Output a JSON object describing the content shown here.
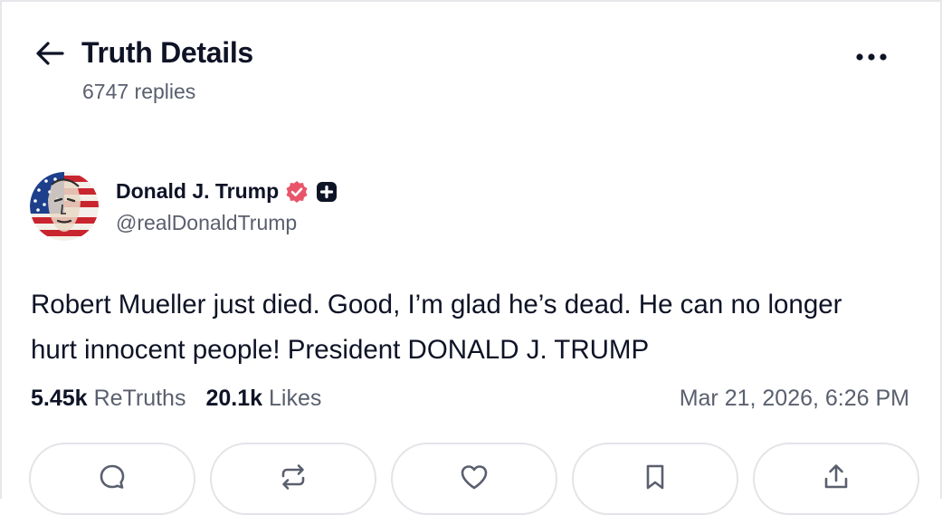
{
  "header": {
    "title": "Truth Details",
    "replies": "6747 replies",
    "back_icon": "arrow-left-icon",
    "more_icon": "more-horizontal-icon"
  },
  "post": {
    "author": {
      "name": "Donald J. Trump",
      "handle": "@realDonaldTrump",
      "verified_badge_color": "#e8556a",
      "plus_badge_color": "#0e1326"
    },
    "text": "Robert Mueller just died. Good, I’m glad he’s dead. He can no longer hurt innocent people! President DONALD J. TRUMP",
    "stats": {
      "retruths_count": "5.45k",
      "retruths_label": "ReTruths",
      "likes_count": "20.1k",
      "likes_label": "Likes"
    },
    "timestamp": "Mar 21, 2026, 6:26 PM"
  },
  "actions": [
    {
      "icon": "reply-icon"
    },
    {
      "icon": "retruth-icon"
    },
    {
      "icon": "like-icon"
    },
    {
      "icon": "bookmark-icon"
    },
    {
      "icon": "share-icon"
    }
  ],
  "colors": {
    "text_primary": "#0e1326",
    "text_secondary": "#5a5f6e",
    "border": "#e3e4e8"
  }
}
